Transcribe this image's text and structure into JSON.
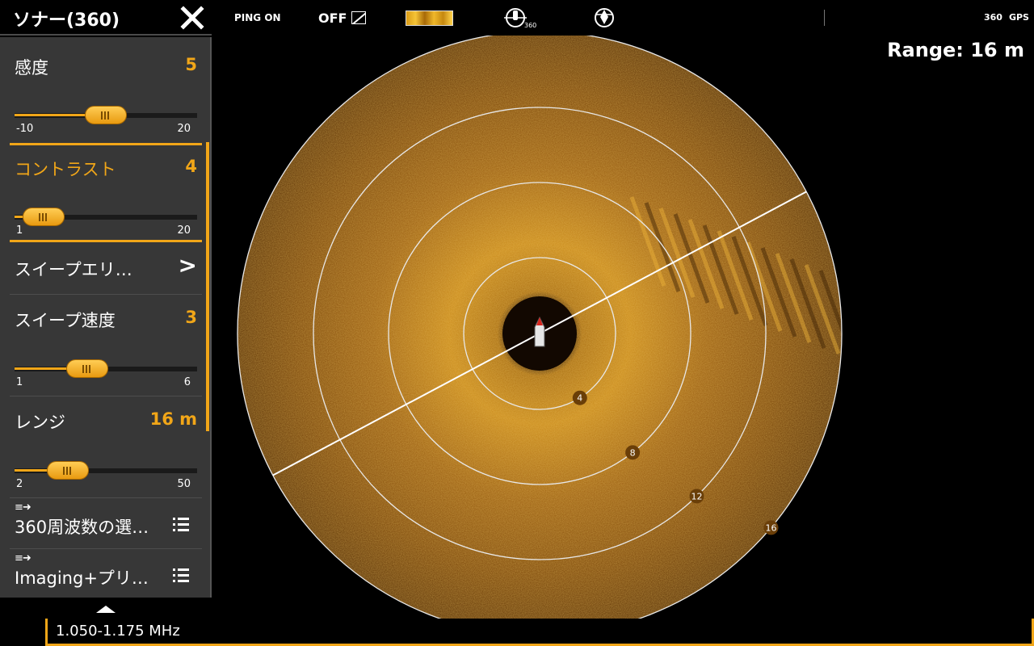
{
  "panel": {
    "title": "ソナー(360)",
    "items": [
      {
        "label": "感度",
        "value": "5",
        "min": "-10",
        "max": "20",
        "level": 5,
        "lo": -10,
        "hi": 20
      },
      {
        "label": "コントラスト",
        "value": "4",
        "min": "1",
        "max": "20",
        "level": 4,
        "lo": 1,
        "hi": 20
      },
      {
        "label": "スイープエリ…",
        "arrow": ">"
      },
      {
        "label": "スイープ速度",
        "value": "3",
        "min": "1",
        "max": "6",
        "level": 3,
        "lo": 1,
        "hi": 6
      },
      {
        "label": "レンジ",
        "value": "16 m",
        "min": "2",
        "max": "50",
        "level": 16,
        "lo": 2,
        "hi": 50
      },
      {
        "label": "360周波数の選…"
      },
      {
        "label": "Imaging+プリ…"
      }
    ]
  },
  "toolbar": {
    "ping": "PING ON",
    "off": "OFF",
    "nav_360": "360",
    "status_360": "360",
    "status_gps": "GPS"
  },
  "sonar": {
    "range_text": "Range: 16 m",
    "ring_labels": [
      "4",
      "8",
      "12",
      "16"
    ],
    "sweep_angle_deg": -28
  },
  "footer": {
    "frequency": "1.050-1.175 MHz"
  },
  "colors": {
    "accent": "#f1a618",
    "panel_bg": "#373737"
  }
}
